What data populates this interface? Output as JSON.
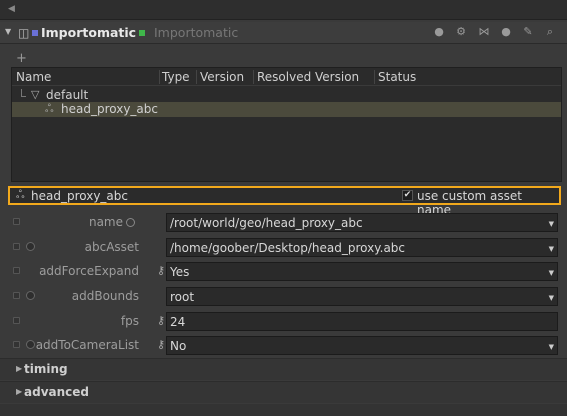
{
  "header": {
    "title": "Importomatic",
    "subtitle": "Importomatic",
    "icons": [
      "dot-icon",
      "gear-icon",
      "graph-icon",
      "comment-icon",
      "wrench-icon",
      "search-icon"
    ]
  },
  "toolbar": {
    "add_label": "+"
  },
  "tree": {
    "columns": [
      "Name",
      "Type",
      "Version",
      "Resolved Version",
      "Status"
    ],
    "rows": [
      {
        "label": "default"
      },
      {
        "label": "head_proxy_abc"
      }
    ]
  },
  "asset_bar": {
    "name": "head_proxy_abc",
    "checkbox_label": "use custom asset name",
    "checked": true
  },
  "params": [
    {
      "label": "name",
      "value": "/root/world/geo/head_proxy_abc"
    },
    {
      "label": "abcAsset",
      "value": "/home/goober/Desktop/head_proxy.abc"
    },
    {
      "label": "addForceExpand",
      "value": "Yes"
    },
    {
      "label": "addBounds",
      "value": "root"
    },
    {
      "label": "fps",
      "value": "24"
    },
    {
      "label": "addToCameraList",
      "value": "No"
    }
  ],
  "sections": [
    {
      "label": "timing"
    },
    {
      "label": "advanced"
    }
  ]
}
